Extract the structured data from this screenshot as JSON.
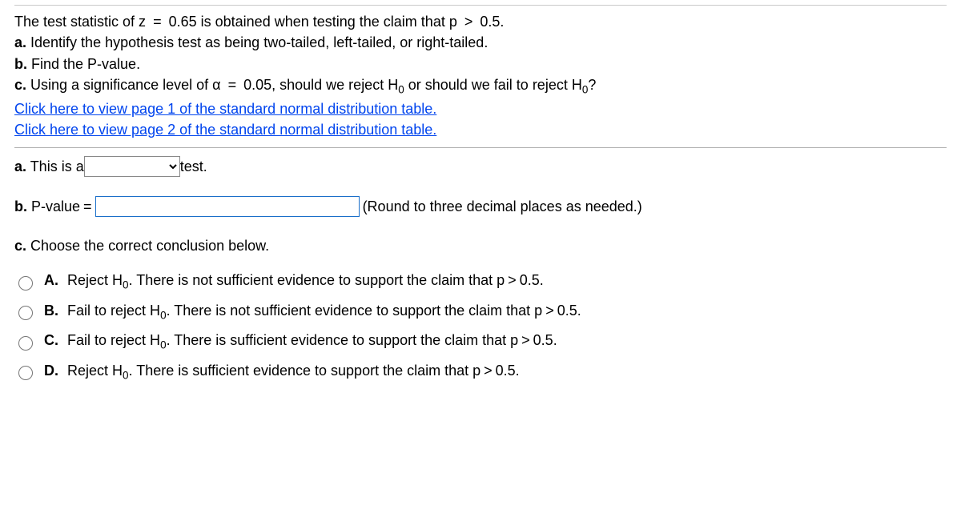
{
  "intro": {
    "l1a": "The test statistic of z",
    "l1b": "=",
    "l1c": "0.65 is obtained when testing the claim that p",
    "l1d": ">",
    "l1e": "0.5.",
    "l2_label": "a.",
    "l2_text": " Identify the hypothesis test as being two-tailed, left-tailed, or right-tailed.",
    "l3_label": "b.",
    "l3_text": " Find the P-value.",
    "l4_label": "c.",
    "l4_a": " Using a significance level of α",
    "l4_b": "=",
    "l4_c": "0.05, should we reject H",
    "l4_sub1": "0",
    "l4_d": " or should we fail to reject H",
    "l4_sub2": "0",
    "l4_e": "?",
    "link1": "Click here to view page 1 of the standard normal distribution table.",
    "link2": "Click here to view page 2 of the standard normal distribution table."
  },
  "partA": {
    "prefix_label": "a.",
    "prefix_text": " This is a ",
    "suffix": " test."
  },
  "partB": {
    "prefix_label": "b.",
    "prefix_text": " P-value",
    "eq": "=",
    "hint": "(Round to three decimal places as needed.)"
  },
  "partC": {
    "prefix_label": "c.",
    "prefix_text": " Choose the correct conclusion below."
  },
  "options": [
    {
      "letter": "A.",
      "t1": "Reject H",
      "sub": "0",
      "t2": ". There is not sufficient evidence to support the claim that p",
      "gt": ">",
      "t3": "0.5."
    },
    {
      "letter": "B.",
      "t1": "Fail to reject H",
      "sub": "0",
      "t2": ". There is not sufficient evidence to support the claim that p",
      "gt": ">",
      "t3": "0.5."
    },
    {
      "letter": "C.",
      "t1": "Fail to reject H",
      "sub": "0",
      "t2": ". There is sufficient evidence to support the claim that p",
      "gt": ">",
      "t3": "0.5."
    },
    {
      "letter": "D.",
      "t1": "Reject H",
      "sub": "0",
      "t2": ". There is sufficient evidence to support the claim that p",
      "gt": ">",
      "t3": "0.5."
    }
  ]
}
